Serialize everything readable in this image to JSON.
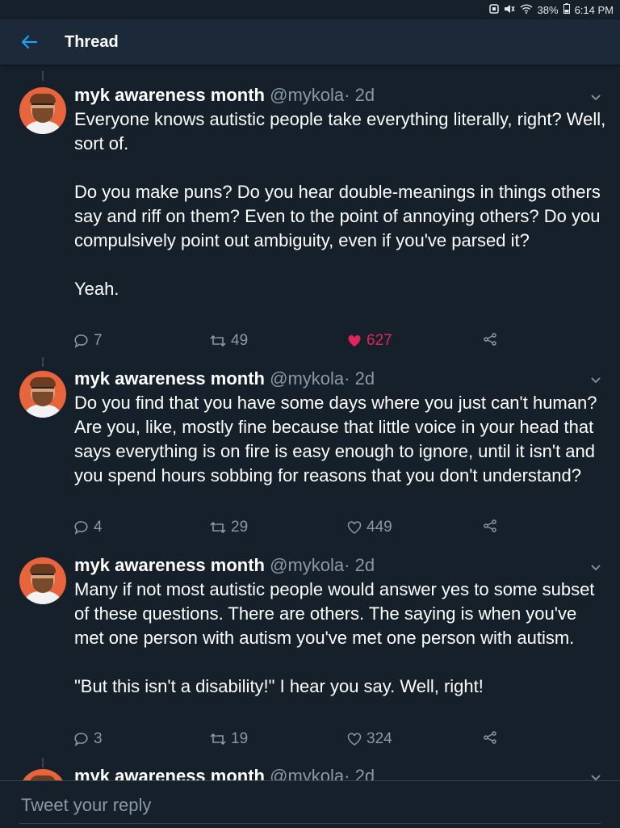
{
  "status_bar": {
    "battery": "38%",
    "time": "6:14 PM"
  },
  "header": {
    "title": "Thread"
  },
  "tweets": [
    {
      "name": "myk awareness month",
      "handle": "@mykola",
      "dot": "·",
      "age": "2d",
      "text": "Everyone knows autistic people take everything literally, right? Well, sort of.\n\nDo you make puns? Do you hear double-meanings in things others say and riff on them? Even to the point of annoying others? Do you compulsively point out ambiguity, even if you've parsed it?\n\nYeah.",
      "replies": "7",
      "retweets": "49",
      "likes": "627",
      "liked": true
    },
    {
      "name": "myk awareness month",
      "handle": "@mykola",
      "dot": "·",
      "age": "2d",
      "text": "Do you find that you have some days where you just can't human? Are you, like, mostly fine because that little voice in your head that says everything is on fire is easy enough to ignore, until it isn't and you spend hours sobbing for reasons that you don't understand?",
      "replies": "4",
      "retweets": "29",
      "likes": "449",
      "liked": false
    },
    {
      "name": "myk awareness month",
      "handle": "@mykola",
      "dot": "·",
      "age": "2d",
      "text": "Many if not most autistic people would answer yes to some subset of these questions. There are others. The saying is when you've met one person with autism you've met one person with autism.\n\n\"But this isn't a disability!\" I hear you say. Well, right!",
      "replies": "3",
      "retweets": "19",
      "likes": "324",
      "liked": false
    },
    {
      "name": "myk awareness month",
      "handle": "@mykola",
      "dot": "·",
      "age": "2d"
    }
  ],
  "reply": {
    "placeholder": "Tweet your reply"
  },
  "colors": {
    "background": "#15202b",
    "accent": "#1da1f2",
    "like": "#e0245e",
    "muted": "#8899a6"
  }
}
